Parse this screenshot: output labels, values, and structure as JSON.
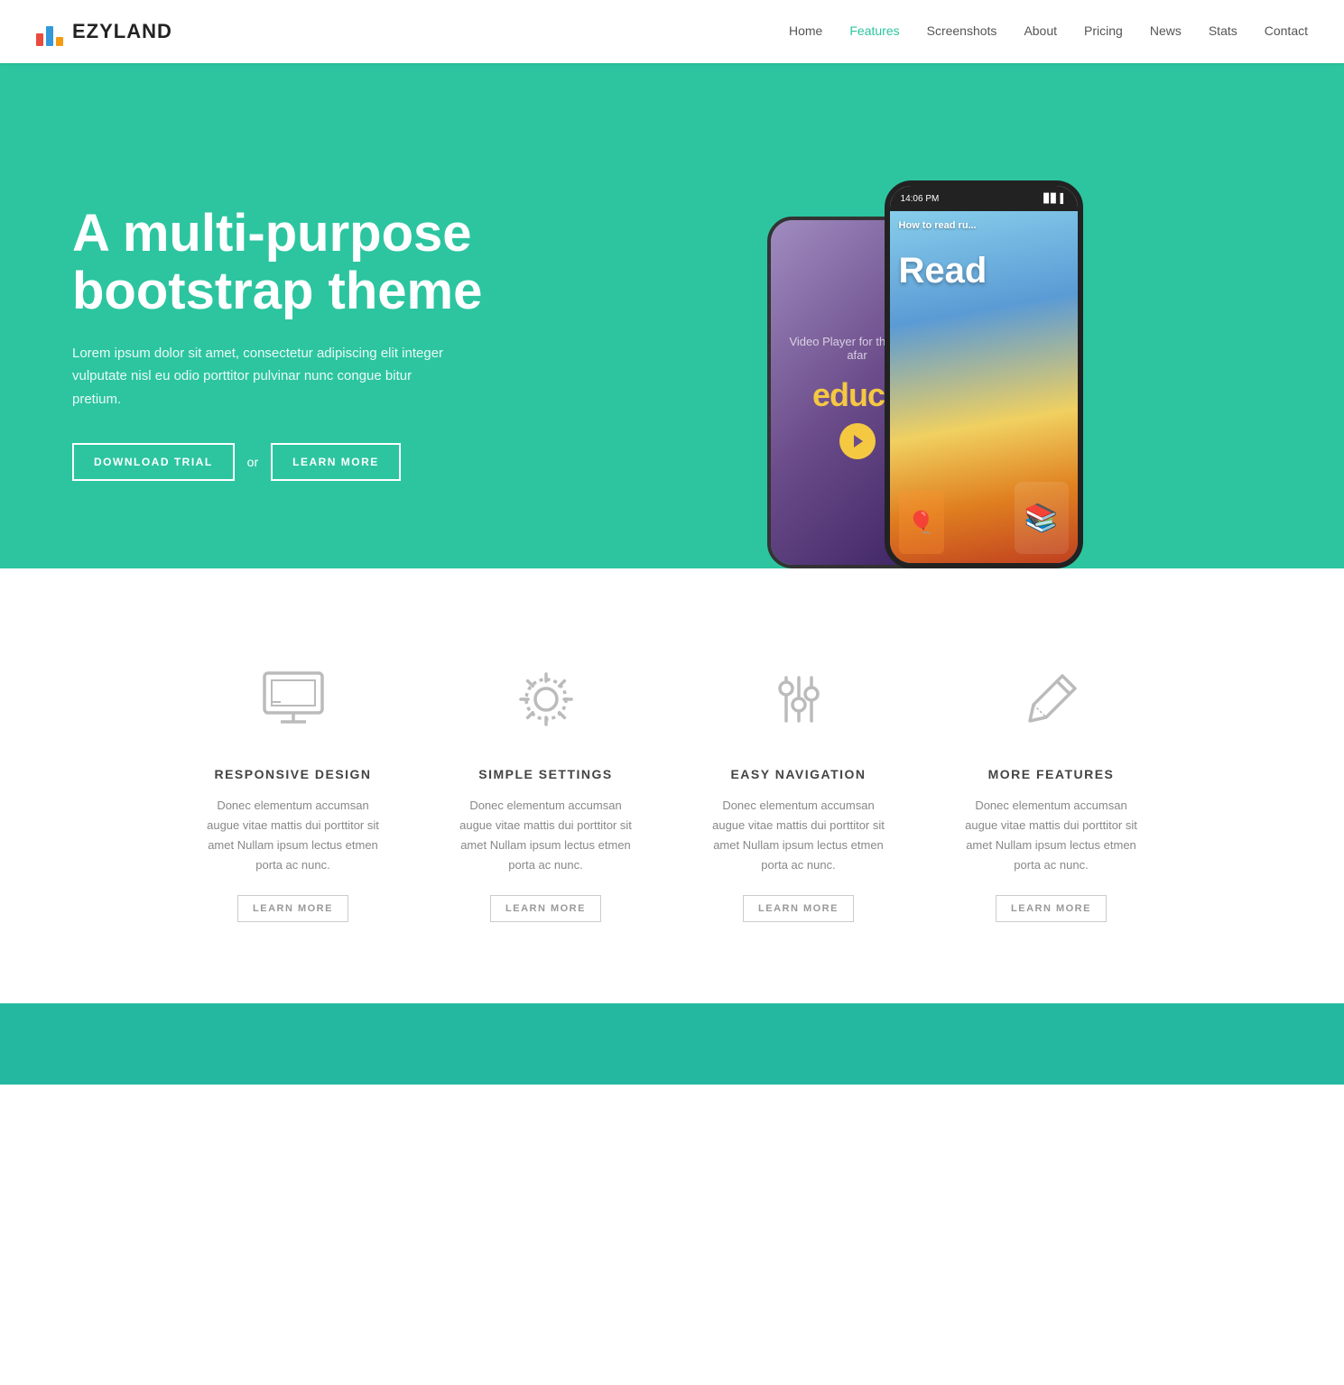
{
  "nav": {
    "logo_text": "EZYLAND",
    "links": [
      {
        "label": "Home",
        "active": false
      },
      {
        "label": "Features",
        "active": true
      },
      {
        "label": "Screenshots",
        "active": false
      },
      {
        "label": "About",
        "active": false
      },
      {
        "label": "Pricing",
        "active": false
      },
      {
        "label": "News",
        "active": false
      },
      {
        "label": "Stats",
        "active": false
      },
      {
        "label": "Contact",
        "active": false
      }
    ]
  },
  "hero": {
    "title": "A multi-purpose bootstrap theme",
    "description": "Lorem ipsum dolor sit amet, consectetur adipiscing elit integer vulputate nisl eu odio porttitor pulvinar nunc congue bitur pretium.",
    "btn_download": "DOWNLOAD TRIAL",
    "btn_or": "or",
    "btn_learn": "LEARN MORE",
    "phone_time": "14:06 PM"
  },
  "features": {
    "items": [
      {
        "id": "responsive-design",
        "icon": "monitor-icon",
        "title": "RESPONSIVE DESIGN",
        "desc": "Donec elementum accumsan augue vitae mattis dui porttitor sit amet Nullam ipsum lectus etmen porta ac nunc.",
        "link": "LEARN MORE"
      },
      {
        "id": "simple-settings",
        "icon": "gear-icon",
        "title": "SIMPLE SETTINGS",
        "desc": "Donec elementum accumsan augue vitae mattis dui porttitor sit amet Nullam ipsum lectus etmen porta ac nunc.",
        "link": "LEARN MORE"
      },
      {
        "id": "easy-navigation",
        "icon": "sliders-icon",
        "title": "EASY NAVIGATION",
        "desc": "Donec elementum accumsan augue vitae mattis dui porttitor sit amet Nullam ipsum lectus etmen porta ac nunc.",
        "link": "LEARN MORE"
      },
      {
        "id": "more-features",
        "icon": "pencil-icon",
        "title": "MORE FEATURES",
        "desc": "Donec elementum accumsan augue vitae mattis dui porttitor sit amet Nullam ipsum lectus etmen porta ac nunc.",
        "link": "LEARN MORE"
      }
    ]
  },
  "logo_colors": {
    "bar1": "#e74c3c",
    "bar2": "#3498db",
    "bar3": "#f39c12"
  }
}
